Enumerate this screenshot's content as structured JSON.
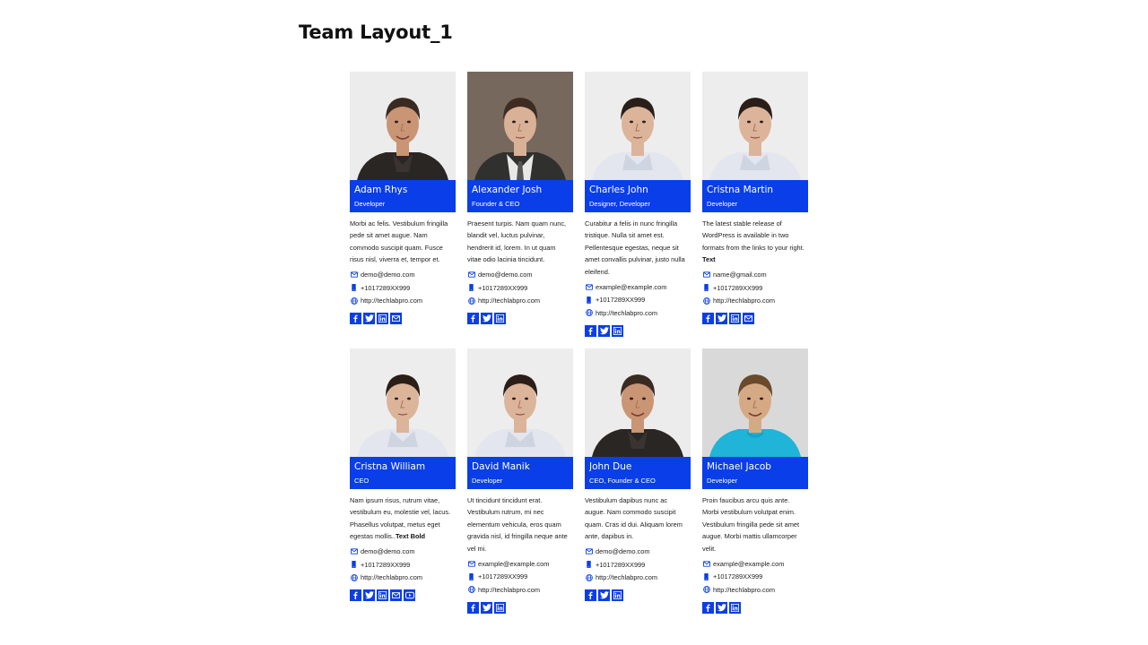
{
  "page": {
    "title": "Team Layout_1"
  },
  "colors": {
    "accent": "#0a3ee8",
    "text": "#222222"
  },
  "members": [
    {
      "name": "Adam Rhys",
      "role": "Developer",
      "bio": "Morbi ac felis. Vestibulum fringilla pede sit amet augue. Nam commodo suscipit quam. Fusce risus nisl, viverra et, tempor et.",
      "bio_bold": "",
      "email": "demo@demo.com",
      "phone": "+1017289XX999",
      "website": "http://techlabpro.com",
      "socials": [
        "facebook-icon",
        "twitter-icon",
        "linkedin-icon",
        "mail-icon"
      ],
      "photo": {
        "bg": "#ececec",
        "skin": "#c99574",
        "hair": "#3a2b22",
        "shirt": "#2a2624",
        "collar": "#3b3330",
        "style": "smile"
      }
    },
    {
      "name": "Alexander Josh",
      "role": "Founder & CEO",
      "bio": "Praesent turpis. Nam quam nunc, blandit vel, luctus pulvinar, hendrerit id, lorem. In ut quam vitae odio lacinia tincidunt.",
      "bio_bold": "",
      "email": "demo@demo.com",
      "phone": "+1017289XX999",
      "website": "http://techlabpro.com",
      "socials": [
        "facebook-icon",
        "twitter-icon",
        "linkedin-icon"
      ],
      "photo": {
        "bg": "#77685e",
        "skin": "#d9b197",
        "hair": "#3e2c22",
        "shirt": "#30302f",
        "collar": "#e8e8e6",
        "style": "suit"
      }
    },
    {
      "name": "Charles John",
      "role": "Designer, Developer",
      "bio": "Curabitur a felis in nunc fringilla tristique. Nulla sit amet est. Pellentesque egestas, neque sit amet convallis pulvinar, justo nulla eleifend.",
      "bio_bold": "",
      "email": "example@example.com",
      "phone": "+1017289XX999",
      "website": "http://techlabpro.com",
      "socials": [
        "facebook-icon",
        "twitter-icon",
        "linkedin-icon"
      ],
      "photo": {
        "bg": "#ededed",
        "skin": "#dcb49a",
        "hair": "#2b1e18",
        "shirt": "#e3e6ef",
        "collar": "#cfd4e1",
        "style": "casual"
      }
    },
    {
      "name": "Cristna Martin",
      "role": "Developer",
      "bio": "The latest stable release of WordPress is available in two formats from the links to your right.",
      "bio_bold": "Text",
      "email": "name@gmail.com",
      "phone": "+1017289XX999",
      "website": "http://techlabpro.com",
      "socials": [
        "facebook-icon",
        "twitter-icon",
        "linkedin-icon",
        "mail-icon"
      ],
      "photo": {
        "bg": "#ededed",
        "skin": "#dcb49a",
        "hair": "#2b1e18",
        "shirt": "#e3e6ef",
        "collar": "#cfd4e1",
        "style": "casual"
      }
    },
    {
      "name": "Cristna William",
      "role": "CEO",
      "bio": "Nam ipsum risus, rutrum vitae, vestibulum eu, molestie vel, lacus. Phasellus volutpat, metus eget egestas mollis..",
      "bio_bold": "Text Bold",
      "email": "demo@demo.com",
      "phone": "+1017289XX999",
      "website": "http://techlabpro.com",
      "socials": [
        "facebook-icon",
        "twitter-icon",
        "linkedin-icon",
        "mail-icon",
        "youtube-icon"
      ],
      "photo": {
        "bg": "#ededed",
        "skin": "#dcb49a",
        "hair": "#2b1e18",
        "shirt": "#e3e6ef",
        "collar": "#cfd4e1",
        "style": "casual"
      }
    },
    {
      "name": "David Manik",
      "role": "Developer",
      "bio": "Ut tincidunt tincidunt erat. Vestibulum rutrum, mi nec elementum vehicula, eros quam gravida nisl, id fringilla neque ante vel mi.",
      "bio_bold": "",
      "email": "example@example.com",
      "phone": "+1017289XX999",
      "website": "http://techlabpro.com",
      "socials": [
        "facebook-icon",
        "twitter-icon",
        "linkedin-icon"
      ],
      "photo": {
        "bg": "#ededed",
        "skin": "#dcb49a",
        "hair": "#2b1e18",
        "shirt": "#e3e6ef",
        "collar": "#cfd4e1",
        "style": "casual"
      }
    },
    {
      "name": "John Due",
      "role": "CEO, Founder & CEO",
      "bio": "Vestibulum dapibus nunc ac augue. Nam commodo suscipit quam. Cras id dui. Aliquam lorem ante, dapibus in.",
      "bio_bold": "",
      "email": "demo@demo.com",
      "phone": "+1017289XX999",
      "website": "http://techlabpro.com",
      "socials": [
        "facebook-icon",
        "twitter-icon",
        "linkedin-icon"
      ],
      "photo": {
        "bg": "#ececec",
        "skin": "#c99574",
        "hair": "#3a2b22",
        "shirt": "#2a2624",
        "collar": "#3b3330",
        "style": "smile"
      }
    },
    {
      "name": "Michael Jacob",
      "role": "Developer",
      "bio": "Proin faucibus arcu quis ante. Morbi vestibulum volutpat enim. Vestibulum fringilla pede sit amet augue. Morbi mattis ullamcorper velit.",
      "bio_bold": "",
      "email": "example@example.com",
      "phone": "+1017289XX999",
      "website": "http://techlabpro.com",
      "socials": [
        "facebook-icon",
        "twitter-icon",
        "linkedin-icon"
      ],
      "photo": {
        "bg": "#d9d9d9",
        "skin": "#d6a985",
        "hair": "#6a4a2c",
        "shirt": "#1fb4d8",
        "collar": "#1aa3c6",
        "style": "tee"
      }
    }
  ]
}
